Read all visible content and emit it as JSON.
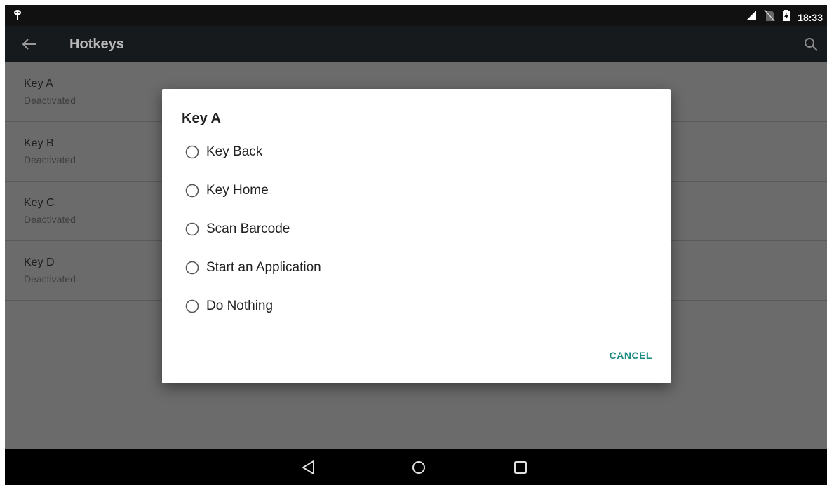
{
  "status_bar": {
    "time": "18:33",
    "icons": [
      "android-debug-icon",
      "signal-icon",
      "no-sim-icon",
      "battery-icon"
    ]
  },
  "app_bar": {
    "title": "Hotkeys",
    "icons": [
      "back-arrow-icon",
      "search-icon"
    ]
  },
  "list": {
    "items": [
      {
        "title": "Key A",
        "subtitle": "Deactivated"
      },
      {
        "title": "Key B",
        "subtitle": "Deactivated"
      },
      {
        "title": "Key C",
        "subtitle": "Deactivated"
      },
      {
        "title": "Key D",
        "subtitle": "Deactivated"
      }
    ]
  },
  "dialog": {
    "title": "Key A",
    "options": [
      {
        "label": "Key Back",
        "selected": false
      },
      {
        "label": "Key Home",
        "selected": false
      },
      {
        "label": "Scan Barcode",
        "selected": false
      },
      {
        "label": "Start an Application",
        "selected": false
      },
      {
        "label": "Do Nothing",
        "selected": false
      }
    ],
    "cancel_label": "CANCEL"
  },
  "nav_bar": {
    "icons": [
      "back-triangle-icon",
      "home-circle-icon",
      "recents-square-icon"
    ]
  },
  "colors": {
    "accent": "#1a8a80",
    "app_bar": "#161a1d",
    "scrim_background": "#6b6b6b"
  }
}
